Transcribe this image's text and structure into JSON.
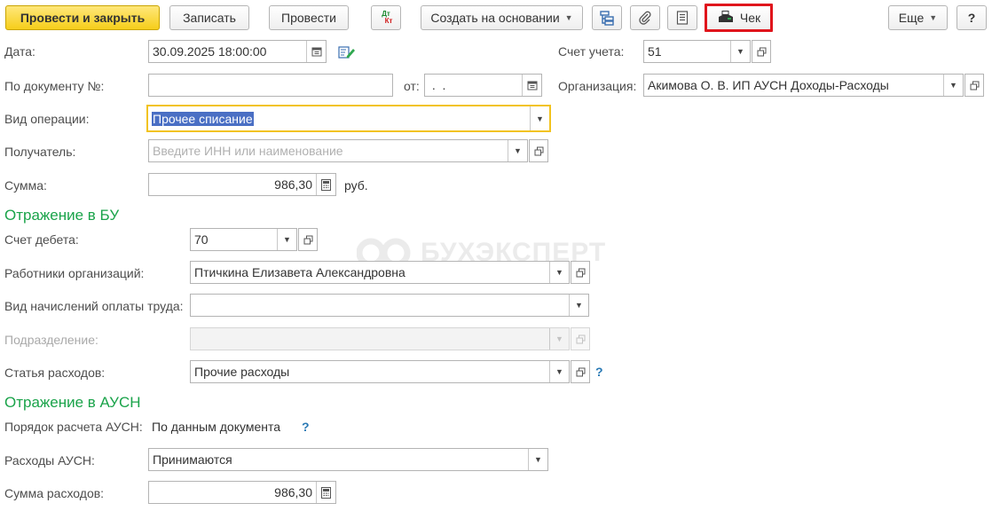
{
  "toolbar": {
    "post_close": "Провести и закрыть",
    "save": "Записать",
    "post": "Провести",
    "dtkt_top": "Дт",
    "dtkt_bottom": "Кт",
    "create_based": "Создать на основании",
    "receipt": "Чек",
    "more": "Еще",
    "help": "?"
  },
  "form": {
    "date_label": "Дата:",
    "date_value": "30.09.2025 18:00:00",
    "account_label": "Счет учета:",
    "account_value": "51",
    "doc_no_label": "По документу №:",
    "doc_no_value": "",
    "from_label": "от:",
    "from_value": " .  .",
    "org_label": "Организация:",
    "org_value": "Акимова О. В. ИП АУСН Доходы-Расходы",
    "operation_label": "Вид операции:",
    "operation_value": "Прочее списание",
    "recipient_label": "Получатель:",
    "recipient_placeholder": "Введите ИНН или наименование",
    "amount_label": "Сумма:",
    "amount_value": "986,30",
    "currency": "руб."
  },
  "bu": {
    "title": "Отражение в БУ",
    "debit_label": "Счет дебета:",
    "debit_value": "70",
    "employees_label": "Работники организаций:",
    "employees_value": "Птичкина Елизавета Александровна",
    "payroll_label": "Вид начислений оплаты труда:",
    "payroll_value": "",
    "dept_label": "Подразделение:",
    "dept_value": "",
    "expense_label": "Статья расходов:",
    "expense_value": "Прочие расходы",
    "help": "?"
  },
  "ausn": {
    "title": "Отражение в АУСН",
    "calc_label": "Порядок расчета АУСН:",
    "calc_value": "По данным документа",
    "help": "?",
    "expenses_label": "Расходы АУСН:",
    "expenses_value": "Принимаются",
    "exp_amount_label": "Сумма расходов:",
    "exp_amount_value": "986,30"
  },
  "watermark": "БУХЭКСПЕРТ",
  "colors": {
    "primary_button": "#f6ce1a",
    "section_title": "#1aa34a",
    "focus_border": "#f2c31f",
    "highlight_border": "#e0151c",
    "selection": "#4a6fc4"
  }
}
